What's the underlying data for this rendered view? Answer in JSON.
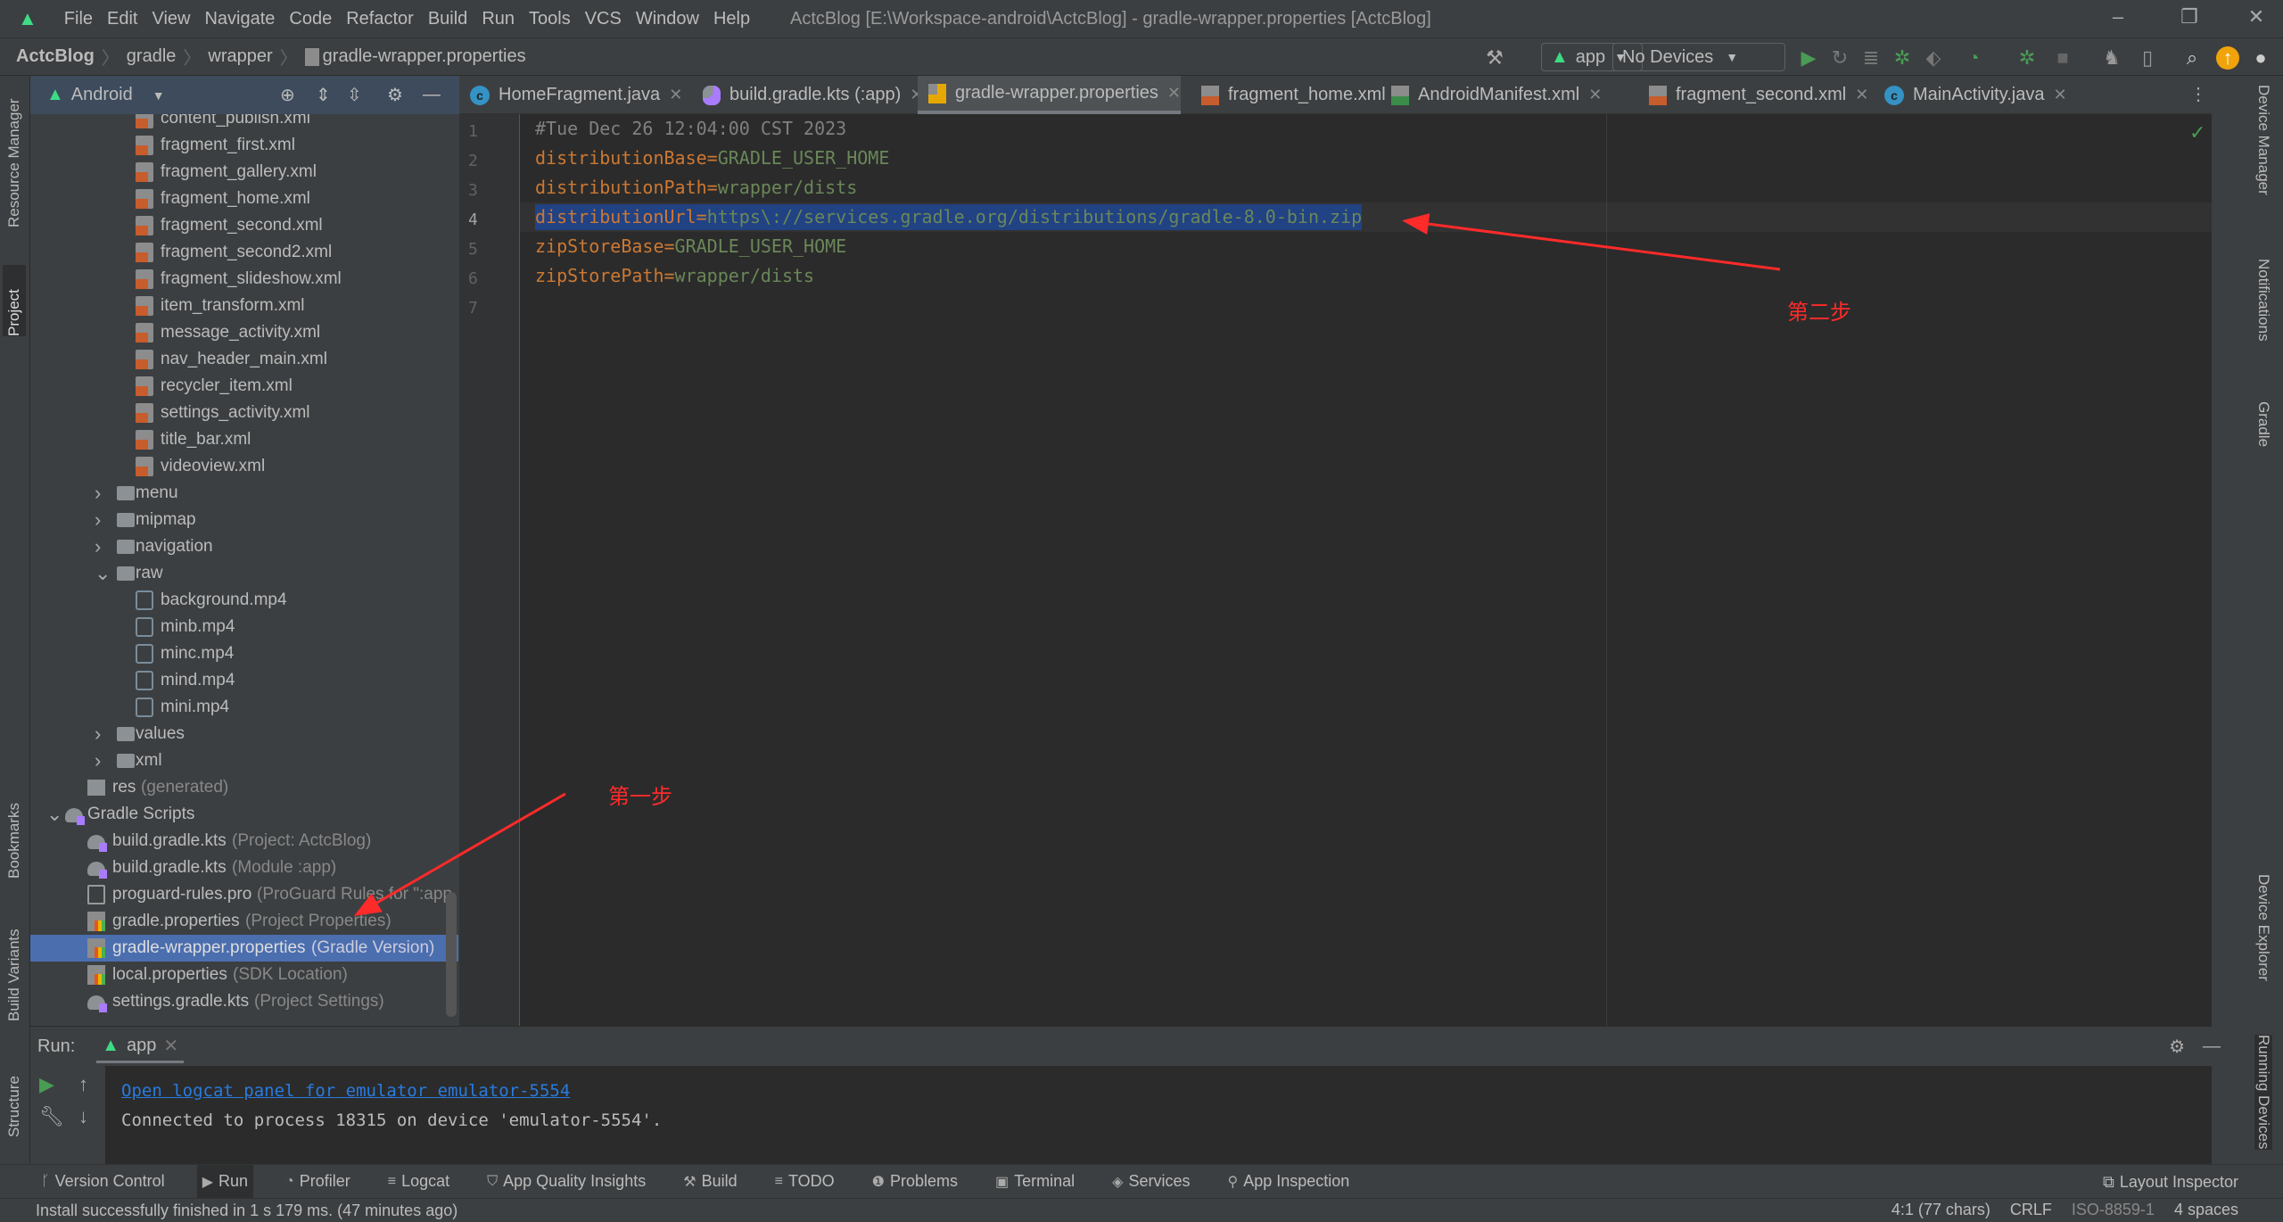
{
  "window": {
    "title": "ActcBlog [E:\\Workspace-android\\ActcBlog] - gradle-wrapper.properties [ActcBlog]",
    "menu": [
      "File",
      "Edit",
      "View",
      "Navigate",
      "Code",
      "Refactor",
      "Build",
      "Run",
      "Tools",
      "VCS",
      "Window",
      "Help"
    ]
  },
  "breadcrumb": [
    "ActcBlog",
    "gradle",
    "wrapper",
    "gradle-wrapper.properties"
  ],
  "toolbar": {
    "config": "app",
    "device": "No Devices"
  },
  "project": {
    "view": "Android",
    "tree": [
      {
        "name": "content_publish.xml",
        "icon": "xml",
        "depth": 3
      },
      {
        "name": "fragment_first.xml",
        "icon": "xml",
        "depth": 3
      },
      {
        "name": "fragment_gallery.xml",
        "icon": "xml",
        "depth": 3
      },
      {
        "name": "fragment_home.xml",
        "icon": "xml",
        "depth": 3
      },
      {
        "name": "fragment_second.xml",
        "icon": "xml",
        "depth": 3
      },
      {
        "name": "fragment_second2.xml",
        "icon": "xml",
        "depth": 3
      },
      {
        "name": "fragment_slideshow.xml",
        "icon": "xml",
        "depth": 3
      },
      {
        "name": "item_transform.xml",
        "icon": "xml",
        "depth": 3
      },
      {
        "name": "message_activity.xml",
        "icon": "xml",
        "depth": 3
      },
      {
        "name": "nav_header_main.xml",
        "icon": "xml",
        "depth": 3
      },
      {
        "name": "recycler_item.xml",
        "icon": "xml",
        "depth": 3
      },
      {
        "name": "settings_activity.xml",
        "icon": "xml",
        "depth": 3
      },
      {
        "name": "title_bar.xml",
        "icon": "xml",
        "depth": 3
      },
      {
        "name": "videoview.xml",
        "icon": "xml",
        "depth": 3
      },
      {
        "name": "menu",
        "icon": "folder",
        "depth": 2,
        "arrow": "right"
      },
      {
        "name": "mipmap",
        "icon": "folder",
        "depth": 2,
        "arrow": "right"
      },
      {
        "name": "navigation",
        "icon": "folder",
        "depth": 2,
        "arrow": "right"
      },
      {
        "name": "raw",
        "icon": "folder",
        "depth": 2,
        "arrow": "down"
      },
      {
        "name": "background.mp4",
        "icon": "media",
        "depth": 3
      },
      {
        "name": "minb.mp4",
        "icon": "media",
        "depth": 3
      },
      {
        "name": "minc.mp4",
        "icon": "media",
        "depth": 3
      },
      {
        "name": "mind.mp4",
        "icon": "media",
        "depth": 3
      },
      {
        "name": "mini.mp4",
        "icon": "media",
        "depth": 3
      },
      {
        "name": "values",
        "icon": "folder",
        "depth": 2,
        "arrow": "right"
      },
      {
        "name": "xml",
        "icon": "folder",
        "depth": 2,
        "arrow": "right"
      },
      {
        "name": "res",
        "hint": "(generated)",
        "icon": "resgen",
        "depth": 1
      },
      {
        "name": "Gradle Scripts",
        "icon": "gradle",
        "depth": 0,
        "arrow": "down"
      },
      {
        "name": "build.gradle.kts",
        "hint": "(Project: ActcBlog)",
        "icon": "gradle",
        "depth": 1
      },
      {
        "name": "build.gradle.kts",
        "hint": "(Module :app)",
        "icon": "gradle",
        "depth": 1
      },
      {
        "name": "proguard-rules.pro",
        "hint": "(ProGuard Rules for \":app",
        "icon": "pro",
        "depth": 1
      },
      {
        "name": "gradle.properties",
        "hint": "(Project Properties)",
        "icon": "props",
        "depth": 1
      },
      {
        "name": "gradle-wrapper.properties",
        "hint": "(Gradle Version)",
        "icon": "props",
        "depth": 1,
        "selected": true
      },
      {
        "name": "local.properties",
        "hint": "(SDK Location)",
        "icon": "props",
        "depth": 1
      },
      {
        "name": "settings.gradle.kts",
        "hint": "(Project Settings)",
        "icon": "gradle",
        "depth": 1
      }
    ]
  },
  "tabs": [
    {
      "label": "HomeFragment.java",
      "icon": "class"
    },
    {
      "label": "build.gradle.kts (:app)",
      "icon": "gradle"
    },
    {
      "label": "gradle-wrapper.properties",
      "icon": "props",
      "active": true
    },
    {
      "label": "fragment_home.xml",
      "icon": "xml"
    },
    {
      "label": "AndroidManifest.xml",
      "icon": "manifest"
    },
    {
      "label": "fragment_second.xml",
      "icon": "xml"
    },
    {
      "label": "MainActivity.java",
      "icon": "class"
    }
  ],
  "editor": {
    "current_line": 4,
    "lines": [
      {
        "n": "1",
        "comment": "#Tue Dec 26 12:04:00 CST 2023"
      },
      {
        "n": "2",
        "key": "distributionBase",
        "value": "GRADLE_USER_HOME"
      },
      {
        "n": "3",
        "key": "distributionPath",
        "value": "wrapper/dists"
      },
      {
        "n": "4",
        "key": "distributionUrl",
        "value": "https\\://services.gradle.org/distributions/gradle-8.0-bin.zip",
        "selected": true
      },
      {
        "n": "5",
        "key": "zipStoreBase",
        "value": "GRADLE_USER_HOME"
      },
      {
        "n": "6",
        "key": "zipStorePath",
        "value": "wrapper/dists"
      },
      {
        "n": "7"
      }
    ]
  },
  "annotations": {
    "step1": "第一步",
    "step2": "第二步",
    "color": "#ff2a2a"
  },
  "left_strip": [
    "Resource Manager",
    "Project",
    "Bookmarks",
    "Build Variants",
    "Structure"
  ],
  "right_strip": [
    "Device Manager",
    "Notifications",
    "Gradle",
    "Device Explorer",
    "Running Devices"
  ],
  "run": {
    "label": "Run:",
    "tab": "app",
    "link": "Open logcat panel for emulator emulator-5554",
    "message": "Connected to process 18315 on device 'emulator-5554'."
  },
  "tool_windows": [
    {
      "label": "Version Control",
      "icon": "branch"
    },
    {
      "label": "Run",
      "icon": "play",
      "active": true
    },
    {
      "label": "Profiler",
      "icon": "gauge"
    },
    {
      "label": "Logcat",
      "icon": "list"
    },
    {
      "label": "App Quality Insights",
      "icon": "shield"
    },
    {
      "label": "Build",
      "icon": "hammer"
    },
    {
      "label": "TODO",
      "icon": "list"
    },
    {
      "label": "Problems",
      "icon": "warning"
    },
    {
      "label": "Terminal",
      "icon": "terminal"
    },
    {
      "label": "Services",
      "icon": "services"
    },
    {
      "label": "App Inspection",
      "icon": "inspect"
    }
  ],
  "layout_inspector": "Layout Inspector",
  "status": {
    "message": "Install successfully finished in 1 s 179 ms. (47 minutes ago)",
    "position": "4:1 (77 chars)",
    "line_sep": "CRLF",
    "encoding": "ISO-8859-1",
    "indent": "4 spaces"
  },
  "colors": {
    "accent": "#4b6eaf",
    "selection": "#214283",
    "key": "#cc7832",
    "value": "#6a8759",
    "comment": "#808080",
    "link": "#287bde"
  }
}
